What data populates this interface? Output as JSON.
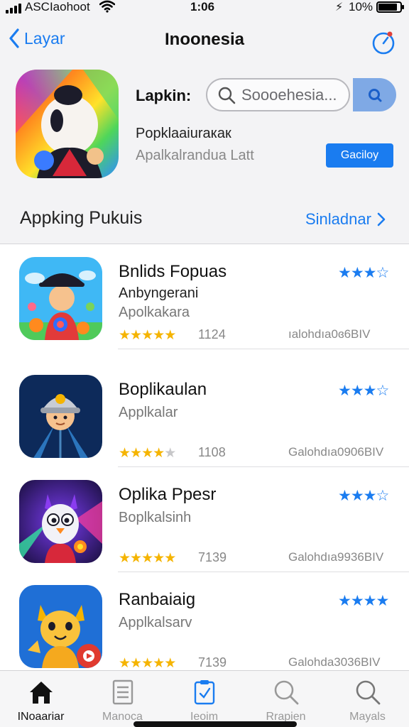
{
  "status_bar": {
    "carrier": "ASCIaohoot",
    "time": "1:06",
    "battery_percent": "10%",
    "battery_level": 0.85
  },
  "nav": {
    "back_label": "Layar",
    "title": "Inoonesia",
    "action_icon": "clock-refresh-icon"
  },
  "hero": {
    "label": "Lapkin:",
    "search_placeholder": "Soooehesia...",
    "subtitle": "Popklaaiuraкак",
    "meta": "Apalkalrandua  Latt",
    "button_label": "Gaciloy"
  },
  "section": {
    "title": "Appking Pukuis",
    "link_label": "Sinladnar"
  },
  "apps": [
    {
      "title": "Bnlids Fopuas",
      "developer": "Anbyngerani",
      "category": "Apolkakara",
      "rating_stars": 4.5,
      "rating_count": "1124",
      "size": "ıalohdıa0ɞ6BIV",
      "blue_stars": 3,
      "blue_stars_max": 4
    },
    {
      "title": "Boplikaulan",
      "developer": "",
      "category": "Applkalar",
      "rating_stars": 3.5,
      "rating_count": "1108",
      "size": "Galohdıa0906BIV",
      "blue_stars": 3,
      "blue_stars_max": 4
    },
    {
      "title": "Oplika Ppesr",
      "developer": "",
      "category": "Boplkalsinh",
      "rating_stars": 4.5,
      "rating_count": "7139",
      "size": "Galohdıa9936BIV",
      "blue_stars": 3,
      "blue_stars_max": 4
    },
    {
      "title": "Ranbaiaig",
      "developer": "",
      "category": "Applkalsarv",
      "rating_stars": 4.5,
      "rating_count": "7139",
      "size": "Galohda3036BIV",
      "blue_stars": 4,
      "blue_stars_max": 4
    }
  ],
  "tabs": [
    {
      "label": "INoaariar",
      "icon": "home-icon",
      "active": true
    },
    {
      "label": "Manoca",
      "icon": "document-icon",
      "active": false
    },
    {
      "label": "Ieoim",
      "icon": "clipboard-icon",
      "active": false
    },
    {
      "label": "Rrapien",
      "icon": "search-icon",
      "active": false
    },
    {
      "label": "Mayals",
      "icon": "search-icon",
      "active": false
    }
  ],
  "colors": {
    "accent": "#1a7cf0",
    "star_gold": "#f5b400",
    "background_top": "#f3f3f5"
  }
}
